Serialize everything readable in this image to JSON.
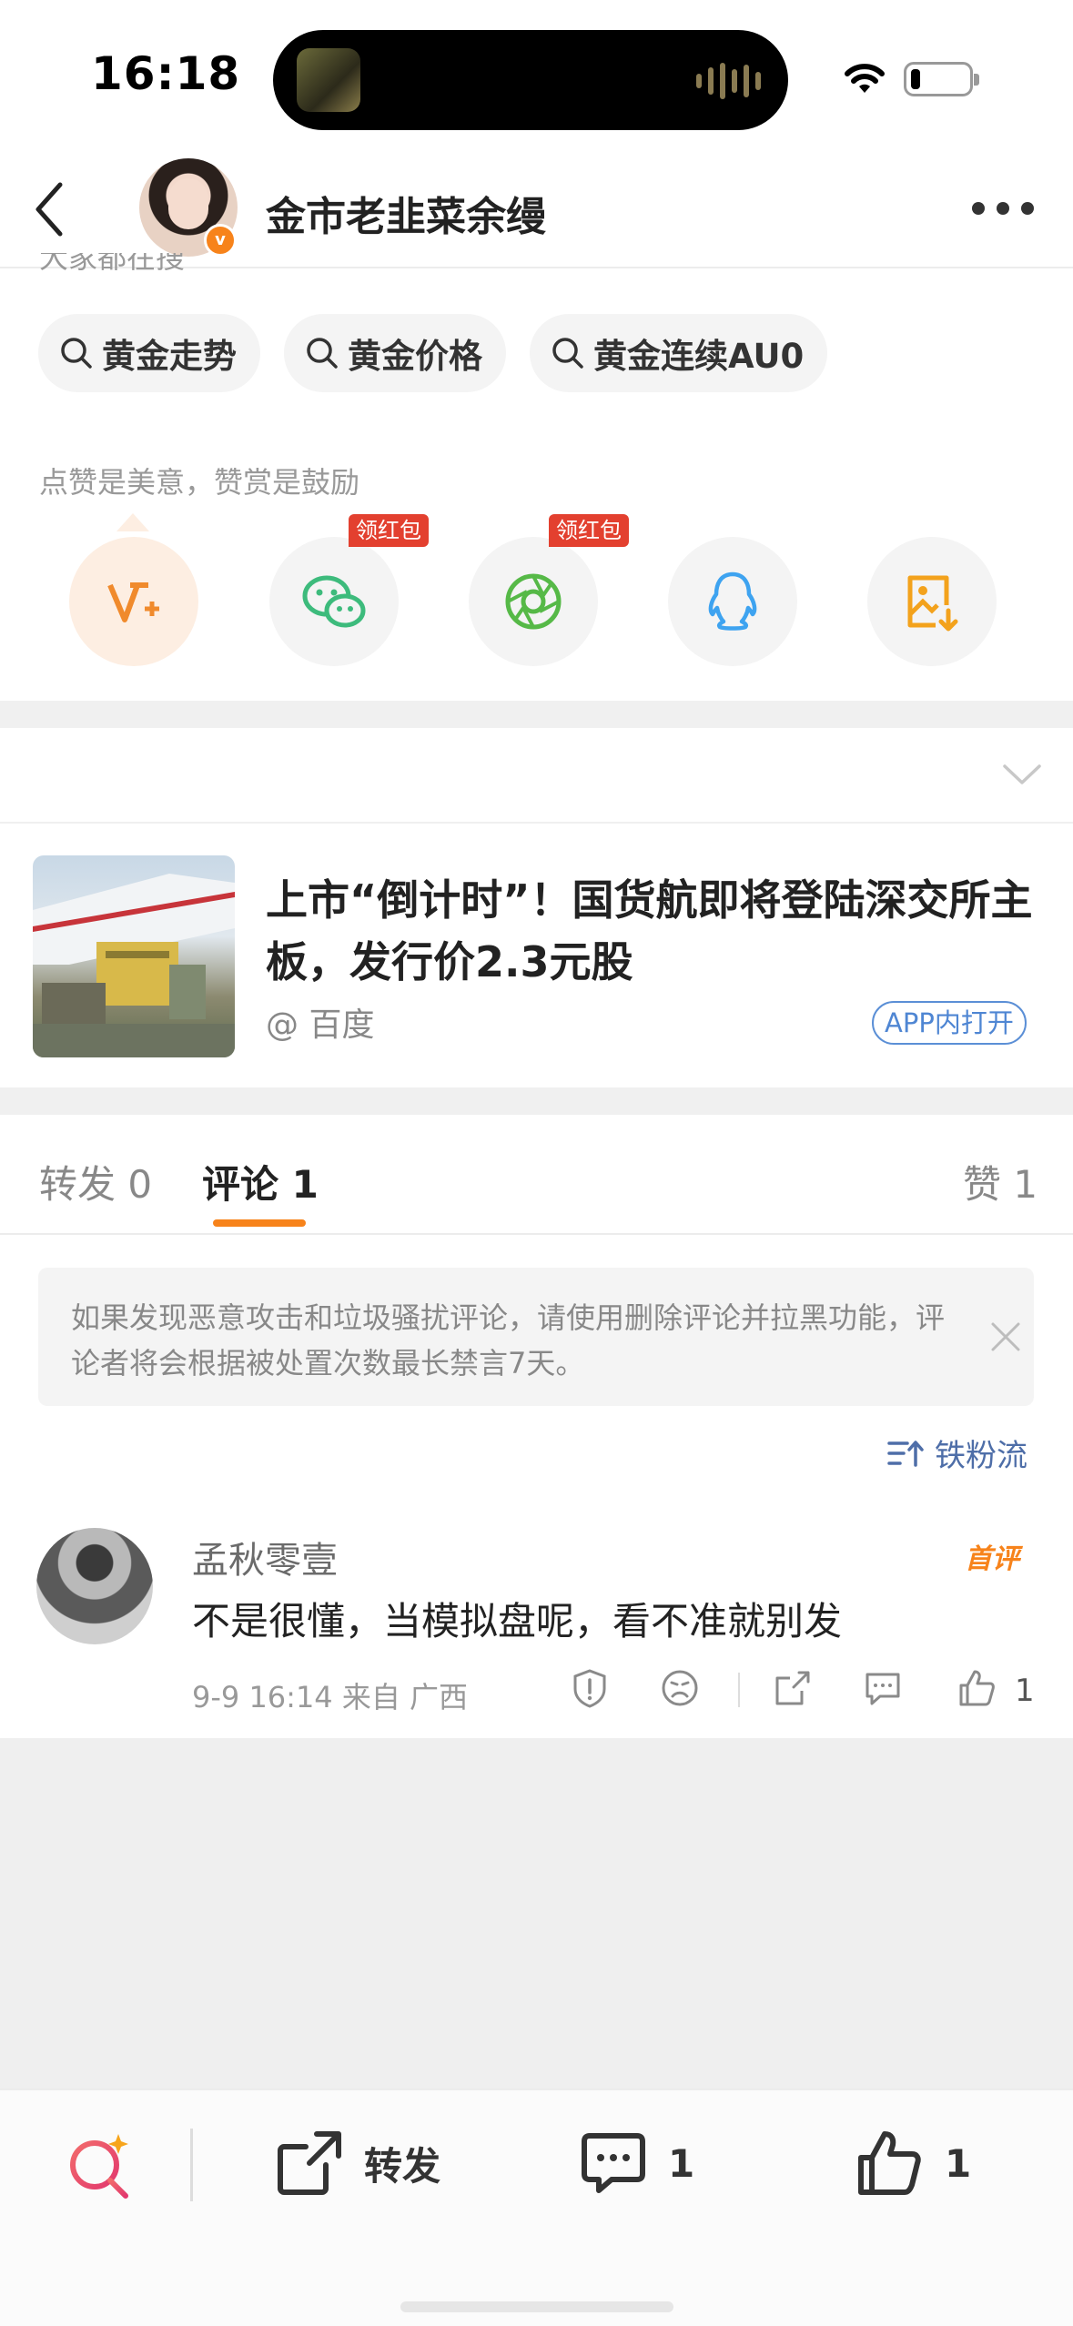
{
  "status_bar": {
    "time": "16:18"
  },
  "header": {
    "username": "金市老韭菜余缦"
  },
  "search": {
    "heading": "大家都在搜",
    "chips": [
      "黄金走势",
      "黄金价格",
      "黄金连续AU0"
    ]
  },
  "reward": {
    "label": "点赞是美意，赞赏是鼓励"
  },
  "share": {
    "red_tag_1": "领红包",
    "red_tag_2": "领红包"
  },
  "link_card": {
    "title": "上市“倒计时”！国货航即将登陆深交所主板，发行价2.3元股",
    "source": "@ 百度",
    "open_label": "APP内打开"
  },
  "tabs": {
    "repost": "转发 0",
    "comments": "评论 1",
    "likes": "赞 1"
  },
  "notice": {
    "text": "如果发现恶意攻击和垃圾骚扰评论，请使用删除评论并拉黑功能，评论者将会根据被处置次数最长禁言7天。"
  },
  "sort": {
    "label": "铁粉流"
  },
  "comment": {
    "name": "孟秋零壹",
    "badge": "首评",
    "text": "不是很懂，当模拟盘呢，看不准就别发",
    "meta": "9-9 16:14  来自 广西",
    "like_count": "1"
  },
  "bottom_bar": {
    "repost_label": "转发",
    "comment_count": "1",
    "like_count": "1"
  },
  "colors": {
    "accent": "#f7831b",
    "link": "#4f86d3",
    "red_tag": "#e3402f"
  }
}
